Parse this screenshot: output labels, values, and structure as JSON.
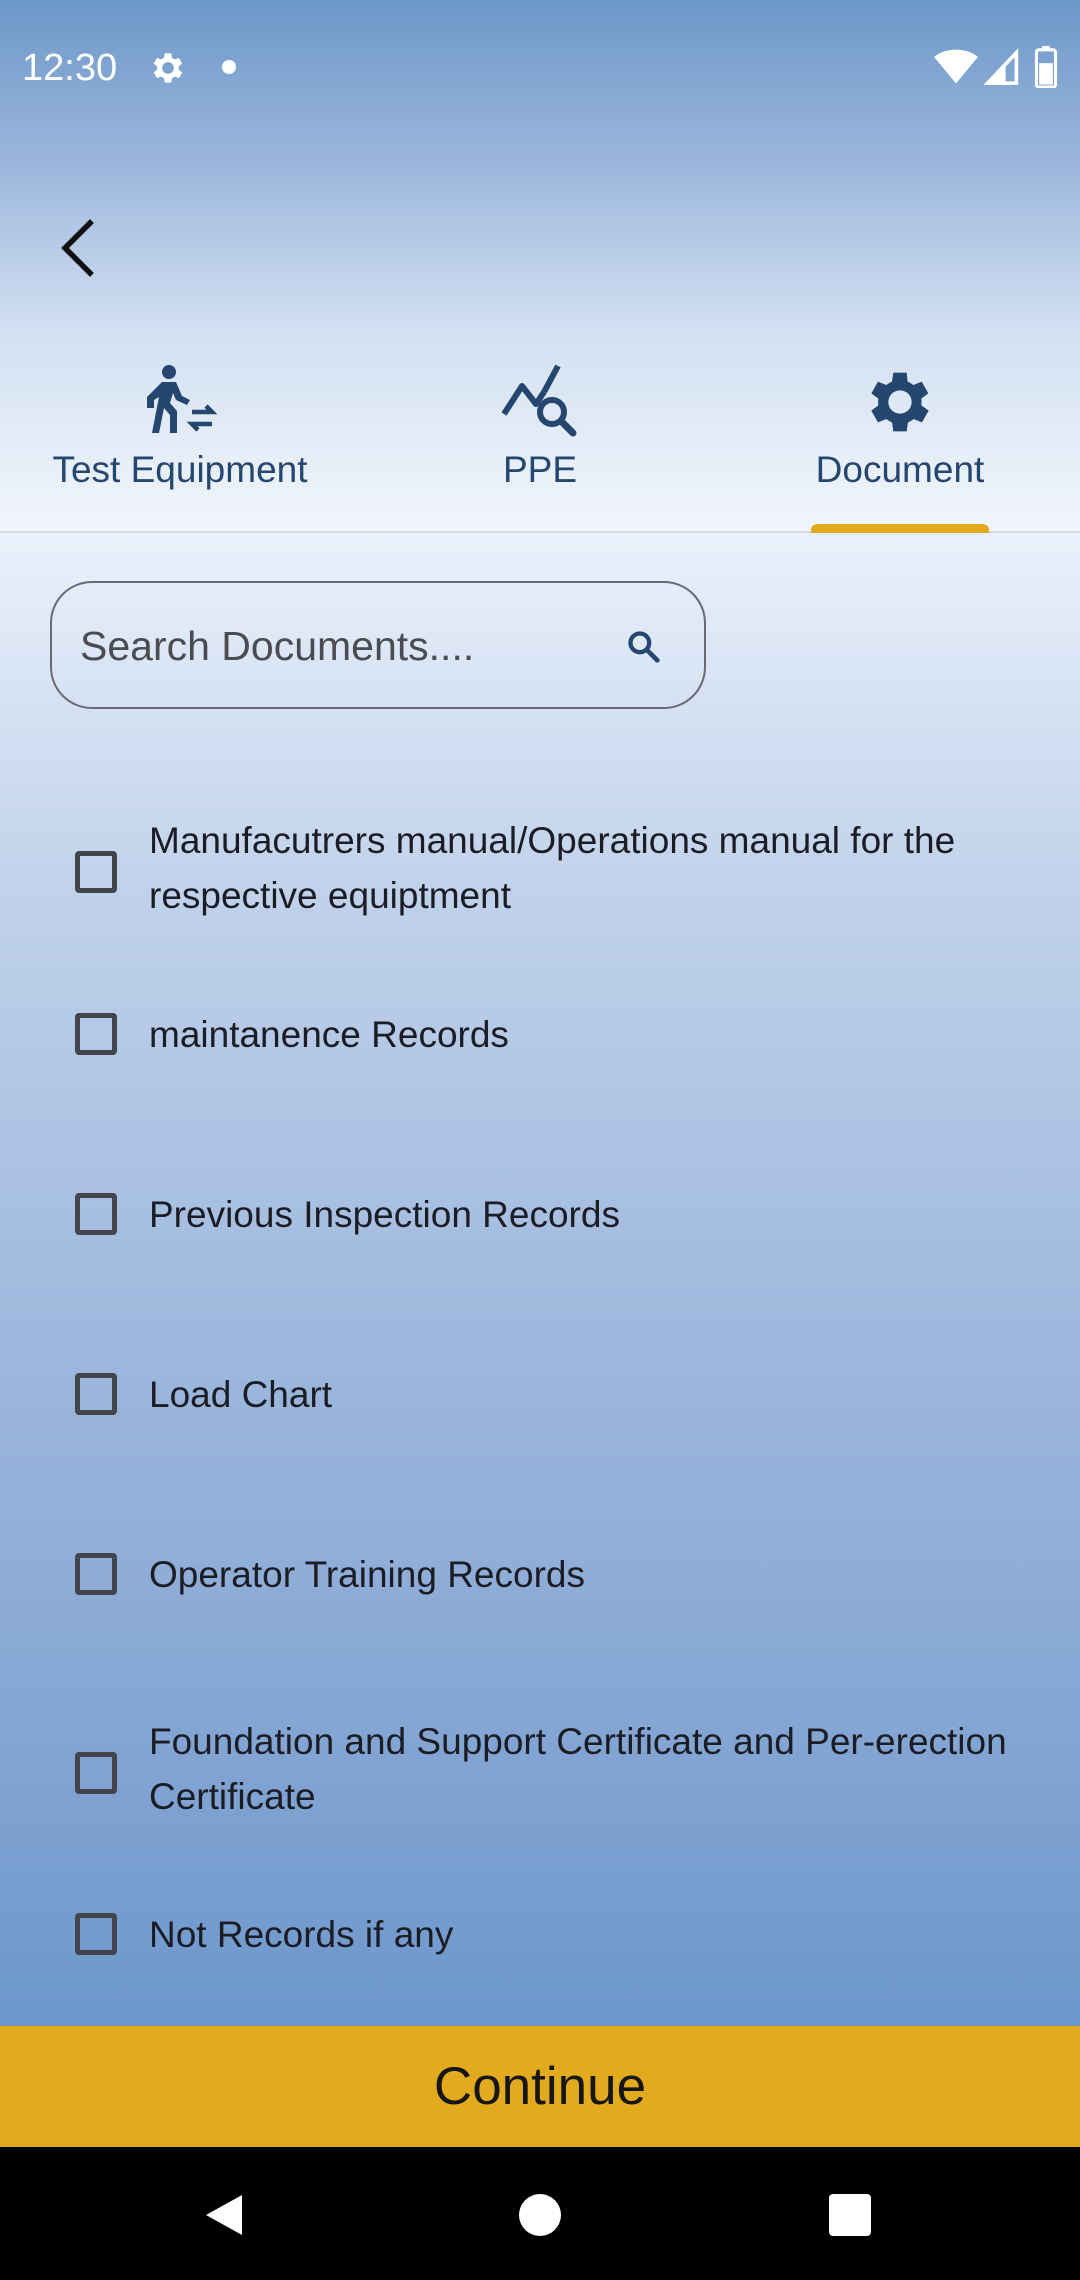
{
  "status_bar": {
    "time": "12:30",
    "icons": [
      "settings-icon",
      "notification-dot-icon",
      "wifi-icon",
      "cell-signal-icon",
      "battery-icon"
    ],
    "color": "#ffffff"
  },
  "header": {
    "back_icon": "chevron-left-icon"
  },
  "tabs": [
    {
      "label": "Test Equipment",
      "icon": "person-walking-swap-icon",
      "selected": false
    },
    {
      "label": "PPE",
      "icon": "query-stats-icon",
      "selected": false
    },
    {
      "label": "Document",
      "icon": "gear-icon",
      "selected": true
    }
  ],
  "search": {
    "placeholder": "Search Documents....",
    "value": "",
    "icon": "search-icon"
  },
  "documents": [
    {
      "label": "Manufacutrers manual/Operations manual for the respective equiptment",
      "checked": false
    },
    {
      "label": "maintanence Records",
      "checked": false
    },
    {
      "label": "Previous Inspection Records",
      "checked": false
    },
    {
      "label": "Load Chart",
      "checked": false
    },
    {
      "label": "Operator Training Records",
      "checked": false
    },
    {
      "label": "Foundation and Support Certificate and Per-erection Certificate",
      "checked": false
    },
    {
      "label": "Not Records if any",
      "checked": false
    }
  ],
  "continue_label": "Continue",
  "nav_bar": {
    "icons": [
      "nav-back-icon",
      "nav-home-icon",
      "nav-recents-icon"
    ]
  },
  "colors": {
    "accent": "#e2aa1d",
    "tab_text": "#24466f",
    "gradient_top": "#6d98c9",
    "gradient_bottom": "#6d97cb"
  }
}
